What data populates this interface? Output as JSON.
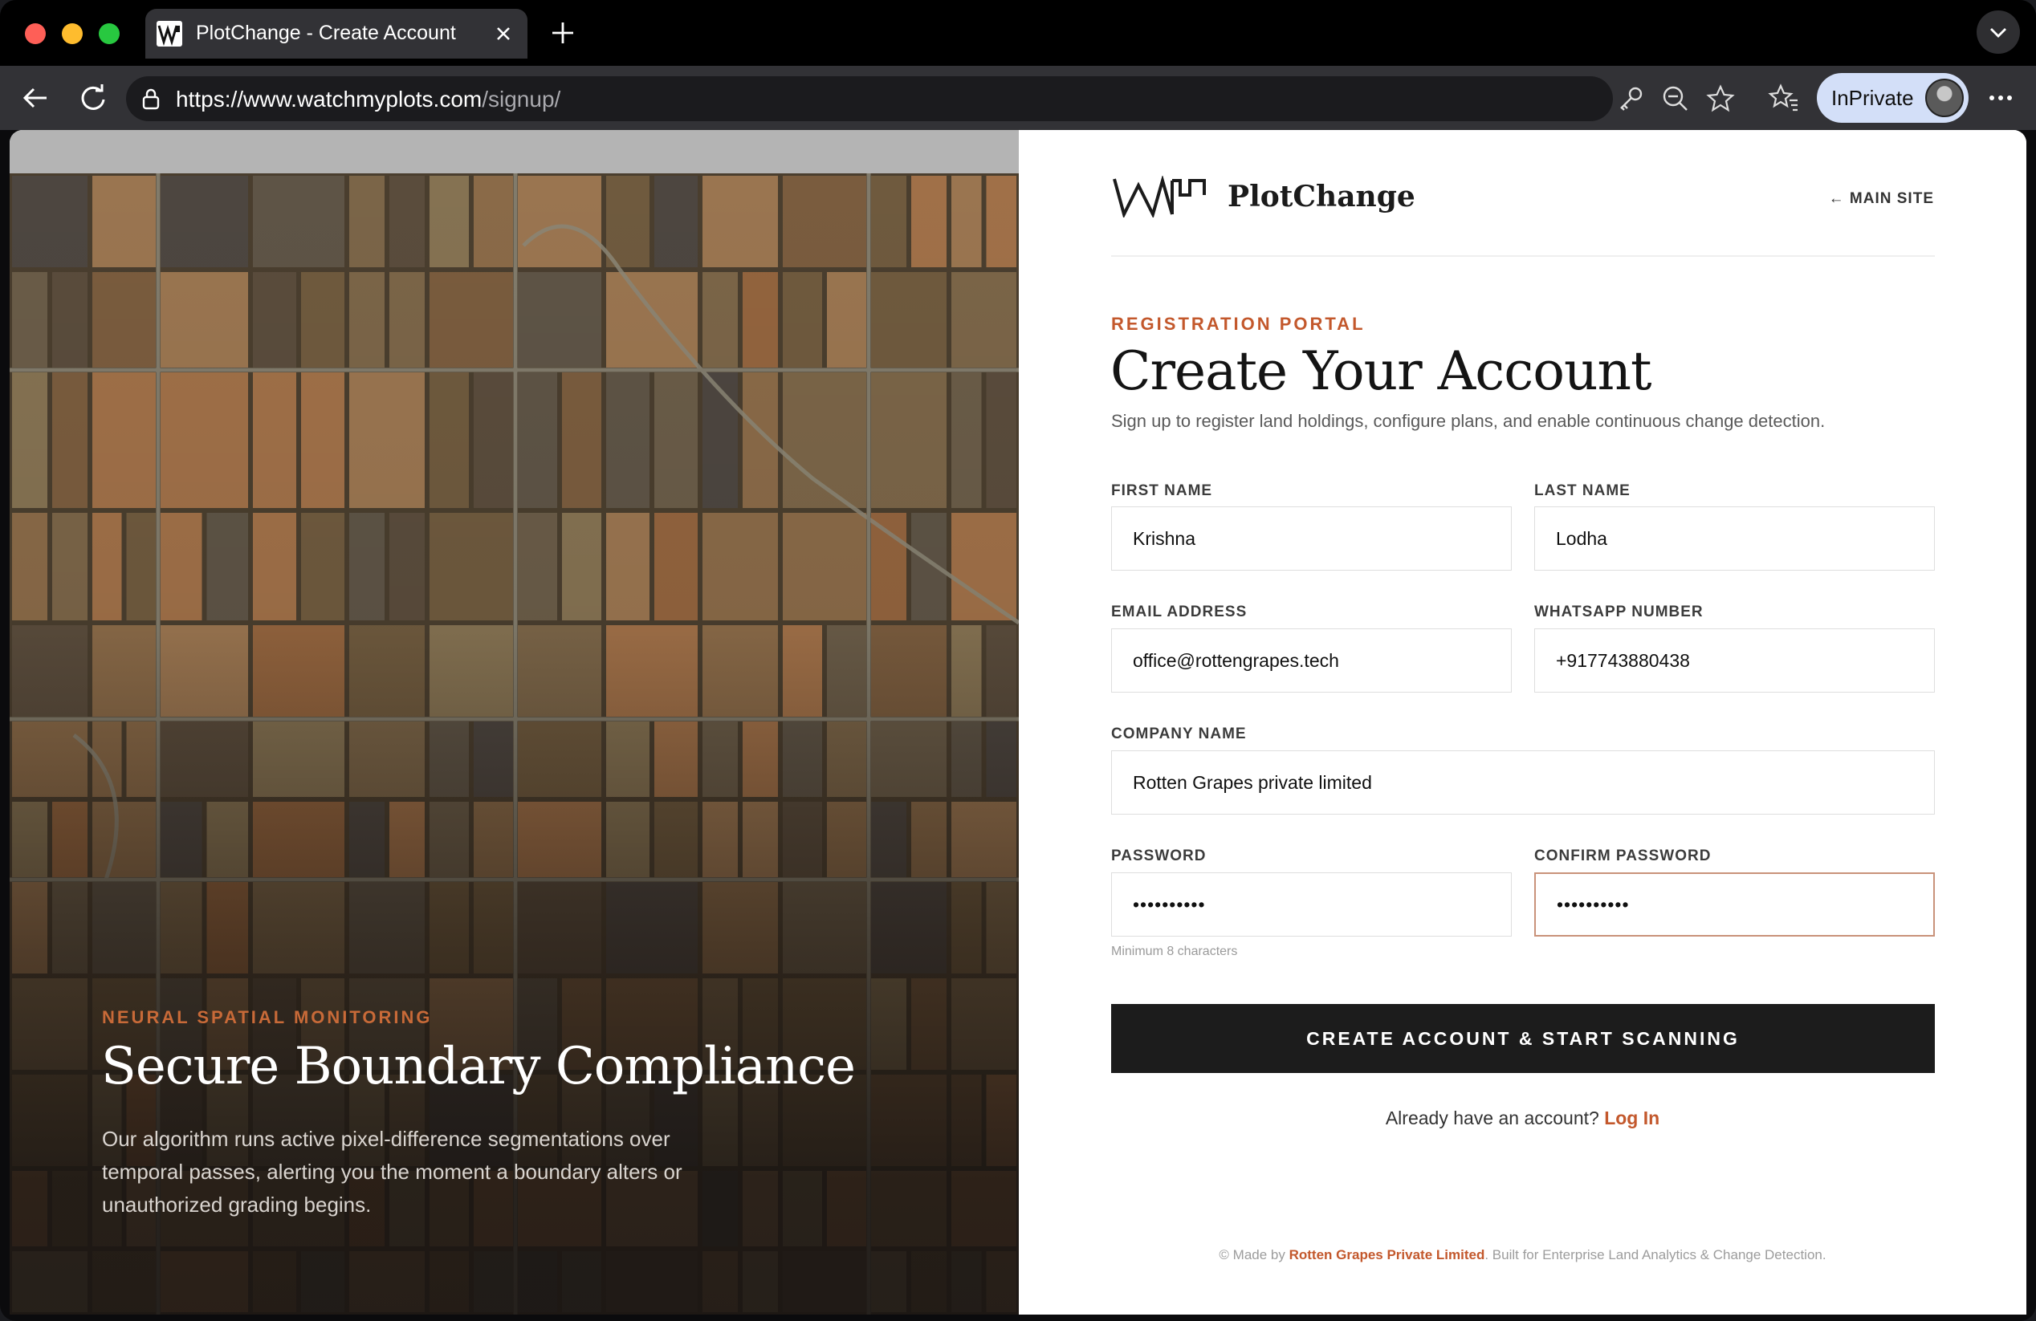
{
  "browser": {
    "tab_title": "PlotChange - Create Account",
    "url_base": "https://www.watchmyplots.com",
    "url_path": "/signup/",
    "profile_label": "InPrivate"
  },
  "hero": {
    "kicker": "NEURAL SPATIAL MONITORING",
    "title": "Secure Boundary Compliance",
    "text": "Our algorithm runs active pixel-difference segmentations over temporal passes, alerting you the moment a boundary alters or unauthorized grading begins."
  },
  "header": {
    "logo_text": "PlotChange",
    "main_site_link": "← MAIN SITE"
  },
  "form": {
    "kicker": "REGISTRATION PORTAL",
    "title": "Create Your Account",
    "subtitle": "Sign up to register land holdings, configure plans, and enable continuous change detection.",
    "first_name": {
      "label": "FIRST NAME",
      "value": "Krishna"
    },
    "last_name": {
      "label": "LAST NAME",
      "value": "Lodha"
    },
    "email": {
      "label": "EMAIL ADDRESS",
      "value": "office@rottengrapes.tech"
    },
    "whatsapp": {
      "label": "WHATSAPP NUMBER",
      "value": "+917743880438"
    },
    "company": {
      "label": "COMPANY NAME",
      "value": "Rotten Grapes private limited"
    },
    "password": {
      "label": "PASSWORD",
      "value": "••••••••••"
    },
    "confirm_password": {
      "label": "CONFIRM PASSWORD",
      "value": "••••••••••"
    },
    "password_hint": "Minimum 8 characters",
    "submit_label": "CREATE ACCOUNT & START SCANNING",
    "login_prompt": "Already have an account?",
    "login_link": "Log In"
  },
  "footer": {
    "prefix": "© Made by ",
    "company": "Rotten Grapes Private Limited",
    "suffix": ". Built for Enterprise Land Analytics & Change Detection."
  },
  "colors": {
    "accent": "#c3582c",
    "button": "#1c1c1c"
  }
}
